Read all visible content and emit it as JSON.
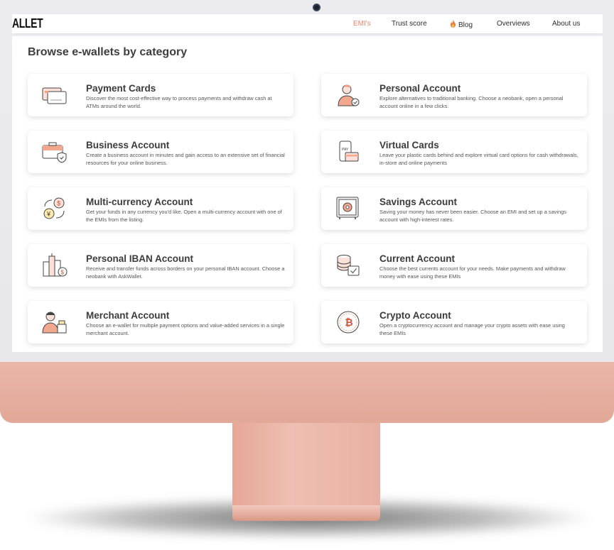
{
  "brand": {
    "logo_text": "ALLET"
  },
  "nav": {
    "items": [
      {
        "label": "EMI's",
        "active": true
      },
      {
        "label": "Trust score",
        "active": false
      },
      {
        "label": "Blog",
        "active": false,
        "icon": "fire-icon"
      },
      {
        "label": "Overviews",
        "active": false
      },
      {
        "label": "About us",
        "active": false
      }
    ]
  },
  "main": {
    "title": "Browse e-wallets by category",
    "cards": [
      {
        "title": "Payment Cards",
        "description": "Discover the most cost-effective way to process payments and withdraw cash at ATMs around the world.",
        "icon": "credit-cards-icon"
      },
      {
        "title": "Personal Account",
        "description": "Explore alternatives to traditional banking. Choose a neobank, open a personal account online in a few clicks.",
        "icon": "person-verified-icon"
      },
      {
        "title": "Business Account",
        "description": "Create a business account in minutes and gain access to an extensive set of financial resources for your online business.",
        "icon": "briefcase-shield-icon"
      },
      {
        "title": "Virtual Cards",
        "description": "Leave your plastic cards behind and explore virtual card options for cash withdrawals, in-store and online payments",
        "icon": "phone-pay-icon"
      },
      {
        "title": "Multi-currency Account",
        "description": "Get your funds in any currency you'd like. Open a multi-currency account with one of the EMIs from the listing.",
        "icon": "currency-exchange-icon"
      },
      {
        "title": "Savings Account",
        "description": "Saving your money has never been easier. Choose an EMI and set up a savings account with high-interest rates.",
        "icon": "safe-icon"
      },
      {
        "title": "Personal IBAN Account",
        "description": "Receive and transfer funds across borders on your personal IBAN account. Choose a neobank with AskWallet.",
        "icon": "city-dollar-icon"
      },
      {
        "title": "Current Account",
        "description": "Choose the best currents account for your needs. Make payments and withdraw money with ease using these EMIs",
        "icon": "coins-check-icon"
      },
      {
        "title": "Merchant Account",
        "description": "Choose an e-wallet for multiple payment options and value-added services in a single merchant account.",
        "icon": "merchant-icon"
      },
      {
        "title": "Crypto Account",
        "description": "Open a cryptocurrency account and manage your crypto assets with ease using these EMIs",
        "icon": "bitcoin-icon"
      }
    ]
  },
  "colors": {
    "accent": "#f0866f",
    "chin": "#e6ad9e",
    "text_dark": "#3b3b3b"
  }
}
